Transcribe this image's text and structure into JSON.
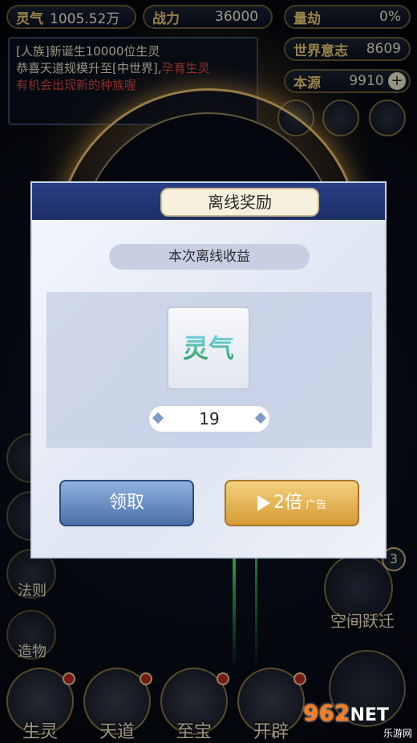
{
  "stats": {
    "lingqi": {
      "label": "灵气",
      "value": "1005.52万"
    },
    "zhanli": {
      "label": "战力",
      "value": "36000"
    },
    "liangjie": {
      "label": "量劫",
      "value": "0%"
    },
    "shijieyizhi": {
      "label": "世界意志",
      "value": "8609"
    },
    "benyuan": {
      "label": "本源",
      "value": "9910"
    }
  },
  "message": {
    "line1": "[人族]新诞生10000位生灵",
    "line2_normal": "恭喜天道规模升至[中世界],",
    "line2_red": "孕育生灵",
    "line3_red": "有机会出现新的种族喔"
  },
  "side_menu": {
    "fazhe": "法则",
    "zaowu": "造物",
    "kongjian": "空间跃迁",
    "badge": "3"
  },
  "bottom_nav": [
    "生灵",
    "天道",
    "至宝",
    "开辟"
  ],
  "modal": {
    "title": "离线奖励",
    "subtitle": "本次离线收益",
    "item_name": "灵气",
    "item_count": "19",
    "claim_label": "领取",
    "double_label": "2倍",
    "ad_label": "广告"
  },
  "watermark": {
    "brand": "962",
    "net": "NET",
    "sub": "乐游网"
  }
}
